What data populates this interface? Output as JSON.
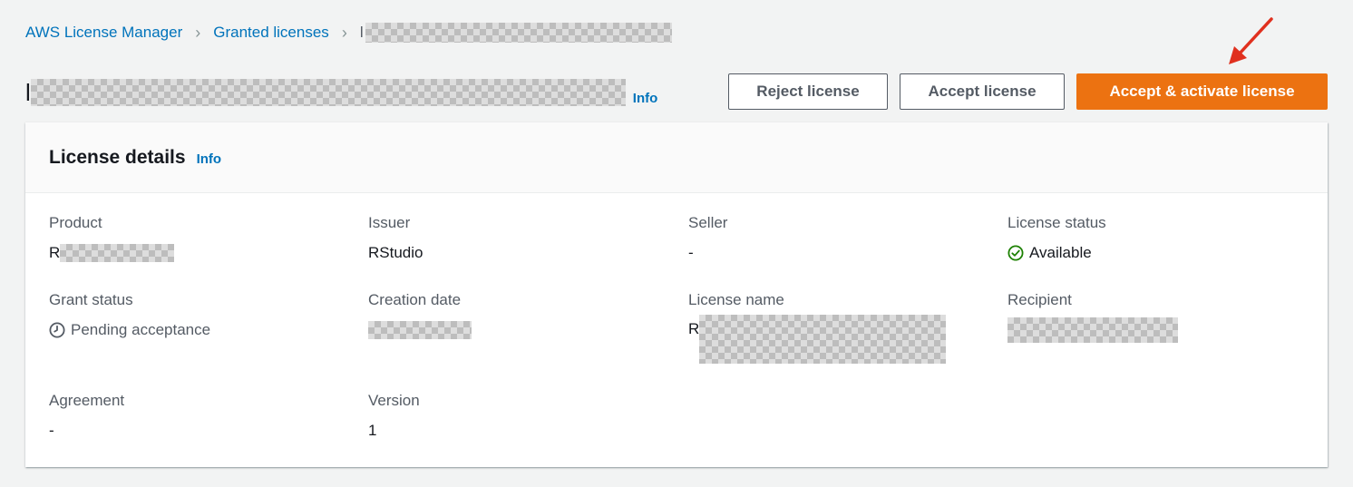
{
  "breadcrumb": {
    "items": [
      "AWS License Manager",
      "Granted licenses"
    ],
    "current_prefix": "l"
  },
  "page": {
    "title_prefix": "l",
    "info_label": "Info"
  },
  "actions": {
    "reject_label": "Reject license",
    "accept_label": "Accept license",
    "accept_activate_label": "Accept & activate license"
  },
  "panel": {
    "title": "License details",
    "info_label": "Info",
    "fields": {
      "product": {
        "label": "Product",
        "value": "R"
      },
      "issuer": {
        "label": "Issuer",
        "value": "RStudio"
      },
      "seller": {
        "label": "Seller",
        "value": "-"
      },
      "license_status": {
        "label": "License status",
        "value": "Available"
      },
      "grant_status": {
        "label": "Grant status",
        "value": "Pending acceptance"
      },
      "creation_date": {
        "label": "Creation date",
        "value": ""
      },
      "license_name": {
        "label": "License name",
        "value": "R"
      },
      "recipient": {
        "label": "Recipient",
        "value": ""
      },
      "agreement": {
        "label": "Agreement",
        "value": "-"
      },
      "version": {
        "label": "Version",
        "value": "1"
      }
    }
  },
  "colors": {
    "link": "#0073bb",
    "primary_button": "#ec7211",
    "success": "#1d8102",
    "annotation_arrow": "#e0301e"
  },
  "icons": {
    "status_available": "check-circle-icon",
    "status_pending": "clock-icon",
    "annotation": "red-arrow-icon"
  }
}
